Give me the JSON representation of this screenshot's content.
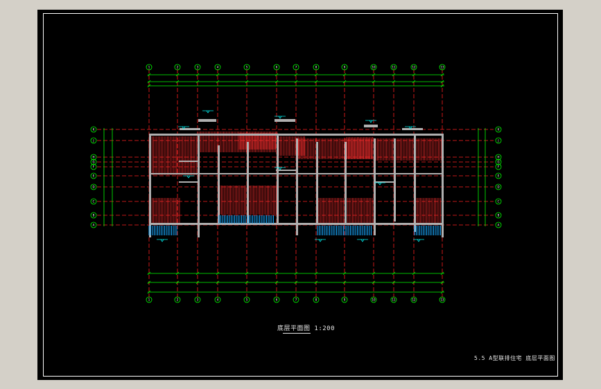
{
  "drawing": {
    "title": "底层平面图 1:200",
    "sheet_caption": "5.5  A型联排住宅  底层平面图",
    "column_axes": [
      "1",
      "2",
      "3",
      "4",
      "5",
      "6",
      "7",
      "8",
      "9",
      "10",
      "11",
      "12",
      "13"
    ],
    "row_axes": [
      "K",
      "J",
      "H",
      "G",
      "F",
      "E",
      "D",
      "C",
      "B",
      "A"
    ],
    "colors": {
      "sheet": "#000000",
      "frame": "#ffffff",
      "axis": "#ff2020",
      "dimension": "#00ff00",
      "wall": "#b0b0b0",
      "hatch": "#ff3030",
      "glazing": "#19a9ff",
      "leader": "#00ffff",
      "text": "#ffffff"
    }
  }
}
